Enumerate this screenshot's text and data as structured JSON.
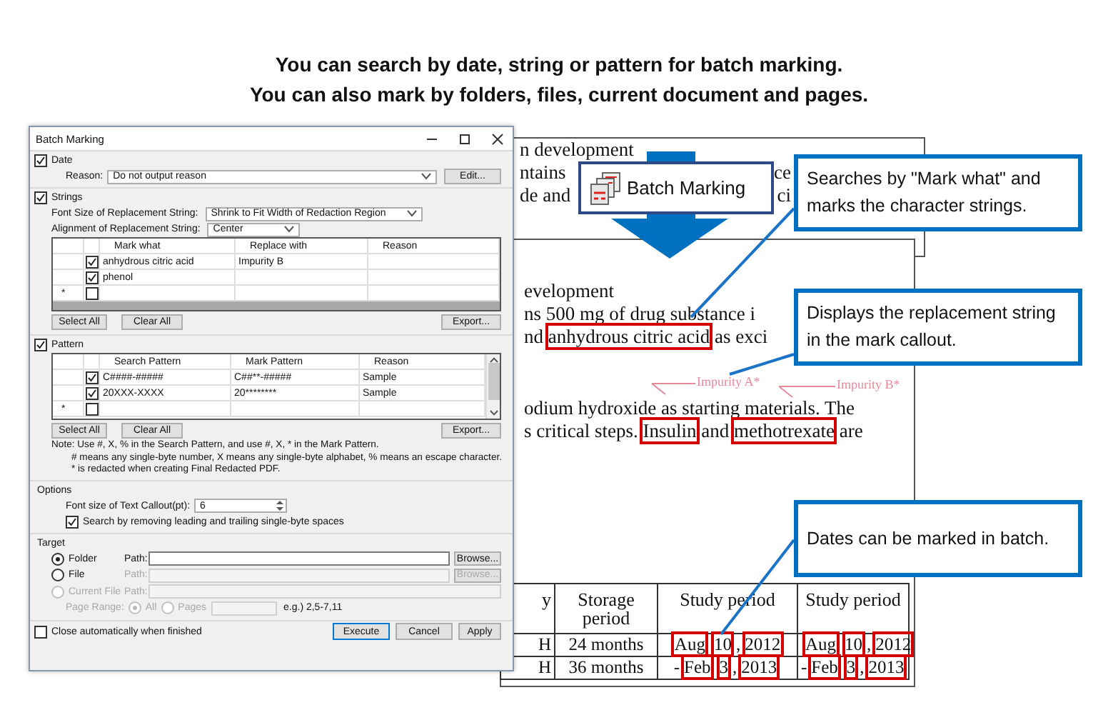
{
  "heading": [
    "You can search by date, string or pattern for batch marking.",
    "You can also mark by folders, files, current document and pages."
  ],
  "back_page": {
    "lines": [
      {
        "left": "n development"
      },
      {
        "left": "ntains",
        "right": "ce"
      },
      {
        "left": "de and",
        "right": "ci"
      }
    ]
  },
  "front_page": {
    "lines_top": [
      {
        "parts": [
          {
            "text": "evelopment",
            "marked": false
          }
        ]
      },
      {
        "parts": [
          {
            "text": "ns 500 mg of drug substance i",
            "marked": false
          }
        ]
      },
      {
        "parts": [
          {
            "text": "nd ",
            "marked": false
          },
          {
            "text": "anhydrous citric acid",
            "marked": true
          },
          {
            "text": " as exci",
            "marked": false
          }
        ]
      }
    ],
    "mark_callouts": [
      {
        "text": "Impurity A*"
      },
      {
        "text": "Impurity B*"
      }
    ],
    "lines_bottom": [
      {
        "parts": [
          {
            "text": "odium hydroxide as starting materials. The",
            "marked": false
          }
        ]
      },
      {
        "parts": [
          {
            "text": "s critical steps. ",
            "marked": false
          },
          {
            "text": "Insulin",
            "marked": true
          },
          {
            "text": " and ",
            "marked": false
          },
          {
            "text": "methotrexate",
            "marked": true
          },
          {
            "text": " are",
            "marked": false
          }
        ]
      }
    ],
    "table": {
      "columns": [
        "y",
        "Storage period",
        "Study period",
        "Study period"
      ],
      "rows": [
        {
          "cells": [
            {
              "parts": [
                {
                  "text": "H",
                  "marked": false
                }
              ]
            },
            {
              "parts": [
                {
                  "text": "24 months",
                  "marked": false
                }
              ]
            },
            {
              "parts": [
                {
                  "text": "Aug",
                  "marked": true
                },
                {
                  "text": "10",
                  "marked": true
                },
                {
                  "text": ",",
                  "marked": false
                },
                {
                  "text": "2012",
                  "marked": true
                }
              ]
            },
            {
              "parts": [
                {
                  "text": "Aug",
                  "marked": true
                },
                {
                  "text": "10",
                  "marked": true
                },
                {
                  "text": ",",
                  "marked": false
                },
                {
                  "text": "2012",
                  "marked": true
                }
              ]
            }
          ]
        },
        {
          "cells": [
            {
              "parts": [
                {
                  "text": "H",
                  "marked": false
                }
              ]
            },
            {
              "parts": [
                {
                  "text": "36 months",
                  "marked": false
                }
              ]
            },
            {
              "parts": [
                {
                  "text": "-",
                  "marked": false
                },
                {
                  "text": "Feb",
                  "marked": true
                },
                {
                  "text": "3",
                  "marked": true
                },
                {
                  "text": ",",
                  "marked": false
                },
                {
                  "text": "2013",
                  "marked": true
                }
              ]
            },
            {
              "parts": [
                {
                  "text": "-",
                  "marked": false
                },
                {
                  "text": "Feb",
                  "marked": true
                },
                {
                  "text": "3",
                  "marked": true
                },
                {
                  "text": ",",
                  "marked": false
                },
                {
                  "text": "2013",
                  "marked": true
                }
              ]
            }
          ]
        }
      ]
    }
  },
  "toolbar_button": {
    "label": "Batch Marking"
  },
  "callouts": [
    {
      "text": "Searches by \"Mark what\" and marks the character strings."
    },
    {
      "text": "Displays the replacement string in the mark callout."
    },
    {
      "text": "Dates can be marked in batch."
    }
  ],
  "dialog": {
    "title": "Batch Marking",
    "date": {
      "label": "Date",
      "checked": true,
      "reason_label": "Reason:",
      "reason_value": "Do not output reason",
      "edit_button": "Edit..."
    },
    "strings": {
      "label": "Strings",
      "checked": true,
      "font_size_label": "Font Size of Replacement String:",
      "font_size_value": "Shrink to Fit Width of Redaction Region",
      "alignment_label": "Alignment of Replacement String:",
      "alignment_value": "Center",
      "columns": [
        "Mark what",
        "Replace with",
        "Reason"
      ],
      "rows": [
        {
          "checked": true,
          "cells": [
            "anhydrous citric acid",
            "Impurity B"
          ]
        },
        {
          "checked": true,
          "cells": [
            "phenol"
          ]
        },
        {
          "marker": "*",
          "checked": false
        }
      ],
      "buttons": [
        "Select All",
        "Clear All",
        "Export..."
      ]
    },
    "pattern": {
      "label": "Pattern",
      "checked": true,
      "columns": [
        "Search Pattern",
        "Mark Pattern",
        "Reason"
      ],
      "rows": [
        {
          "checked": true,
          "cells": [
            "C####-#####",
            "C##**-#####",
            "Sample"
          ]
        },
        {
          "checked": true,
          "cells": [
            "20XXX-XXXX",
            "20********",
            "Sample"
          ]
        },
        {
          "marker": "*",
          "checked": false
        }
      ],
      "buttons": [
        "Select All",
        "Clear All",
        "Export..."
      ]
    },
    "note": [
      "Note: Use #, X, % in the Search Pattern, and use #, X, * in the Mark Pattern.",
      "# means any single-byte number, X means any single-byte alphabet, % means an escape character.",
      "* is redacted when creating Final Redacted PDF."
    ],
    "options": {
      "label": "Options",
      "font_size_label": "Font size of Text Callout(pt):",
      "font_size_value": "6",
      "trim_label": "Search by removing leading and trailing single-byte spaces",
      "trim_checked": true
    },
    "target": {
      "label": "Target",
      "choices": [
        {
          "label": "Folder",
          "selected": true,
          "disabled": false,
          "path_label": "Path:",
          "path_disabled": false,
          "browse": "Browse..."
        },
        {
          "label": "File",
          "selected": false,
          "disabled": false,
          "path_label": "Path:",
          "path_disabled": true,
          "browse": "Browse..."
        },
        {
          "label": "Current File",
          "selected": false,
          "disabled": true,
          "path_label": "Path:",
          "path_disabled": true
        }
      ],
      "page_range": {
        "label": "Page Range:",
        "disabled": true,
        "options": [
          {
            "label": "All",
            "selected": true
          },
          {
            "label": "Pages",
            "selected": false
          }
        ],
        "hint": "e.g.) 2,5-7,11"
      }
    },
    "close_auto": {
      "label": "Close automatically when finished",
      "checked": false
    },
    "buttons": [
      {
        "label": "Execute",
        "default": true
      },
      {
        "label": "Cancel",
        "default": false
      },
      {
        "label": "Apply",
        "default": false
      }
    ]
  }
}
